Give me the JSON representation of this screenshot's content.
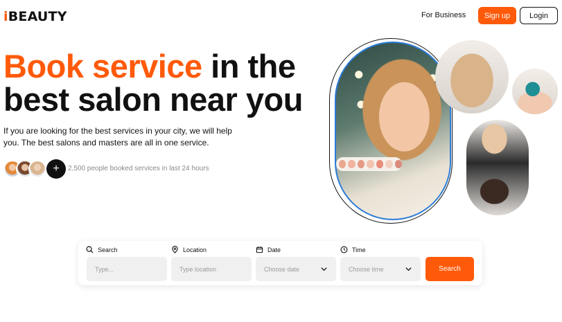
{
  "header": {
    "logo_i": "i",
    "logo_rest": "BEAUTY",
    "nav_business": "For Business",
    "signup_label": "Sign up",
    "login_label": "Login"
  },
  "hero": {
    "title_accent": "Book service",
    "title_rest": " in the best salon near you",
    "description": "If you are looking for the best services in your city, we will help you. The best salons and masters are all in one service.",
    "plus_label": "+",
    "booked_text": "2,500 people booked services in last 24 hours"
  },
  "search": {
    "fields": [
      {
        "label": "Search",
        "placeholder": "Type...",
        "icon": "search-icon"
      },
      {
        "label": "Location",
        "placeholder": "Type location",
        "icon": "location-pin-icon"
      },
      {
        "label": "Date",
        "placeholder": "Choose date",
        "icon": "calendar-icon"
      },
      {
        "label": "Time",
        "placeholder": "Choose time",
        "icon": "clock-icon"
      }
    ],
    "button_label": "Search"
  },
  "colors": {
    "accent": "#ff5a0a",
    "outline_blue": "#2b7bd6",
    "palette": [
      "#e9a88f",
      "#f0b3a0",
      "#e59a86",
      "#f2c2ae",
      "#e88c7a",
      "#f3d0bf",
      "#d98b7b"
    ]
  }
}
